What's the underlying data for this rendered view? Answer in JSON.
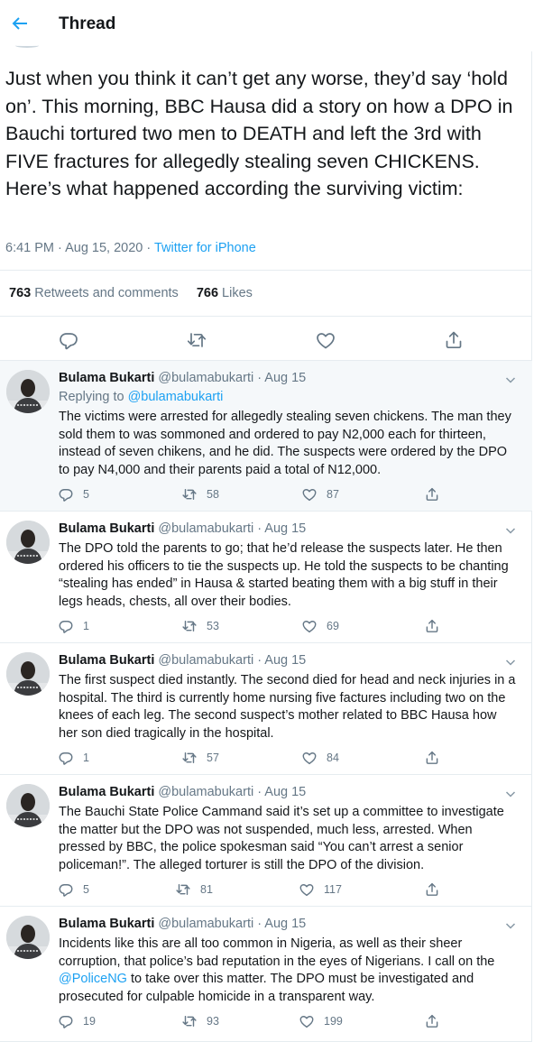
{
  "header": {
    "title": "Thread"
  },
  "main_tweet": {
    "text": "Just when you think it can’t get any worse, they’d say ‘hold on’. This morning, BBC Hausa did a story on how a DPO in Bauchi tortured two men to DEATH and left the 3rd with FIVE fractures for allegedly stealing seven CHICKENS. Here’s what happened according the surviving victim:",
    "time": "6:41 PM · Aug 15, 2020 · ",
    "source": "Twitter for iPhone",
    "retweets_count": "763",
    "retweets_label": "Retweets and comments",
    "likes_count": "766",
    "likes_label": "Likes"
  },
  "replies": [
    {
      "name": "Bulama Bukarti",
      "handle": " @bulamabukarti · Aug 15",
      "replying_prefix": "Replying to ",
      "replying_to": "@bulamabukarti",
      "text": "The victims were arrested for allegedly stealing seven chickens. The man they sold them to was sommoned and ordered to pay N2,000 each for thirteen, instead of seven chikens, and he did. The suspects were ordered by the DPO to pay N4,000 and their parents paid a total of N12,000.",
      "replies": "5",
      "retweets": "58",
      "likes": "87"
    },
    {
      "name": "Bulama Bukarti",
      "handle": " @bulamabukarti · Aug 15",
      "text": "The DPO told the parents to go; that he’d release the suspects later. He then ordered his officers to tie the suspects up. He told the suspects to be chanting “stealing has ended” in Hausa & started beating them with a big stuff in their legs heads, chests, all over their bodies.",
      "replies": "1",
      "retweets": "53",
      "likes": "69"
    },
    {
      "name": "Bulama Bukarti",
      "handle": " @bulamabukarti · Aug 15",
      "text": "The first suspect died instantly. The second died for head and neck injuries in a hospital. The third is currently home nursing five factures including two on the knees of each leg. The second suspect’s mother related to BBC Hausa how her son died tragically in the hospital.",
      "replies": "1",
      "retweets": "57",
      "likes": "84"
    },
    {
      "name": "Bulama Bukarti",
      "handle": " @bulamabukarti · Aug 15",
      "text": "The Bauchi State Police Cammand said it’s set up a committee to investigate the matter but the DPO was not suspended, much less, arrested. When pressed by BBC, the police spokesman said “You can’t arrest a senior policeman!”. The alleged torturer is still the DPO of the division.",
      "replies": "5",
      "retweets": "81",
      "likes": "117"
    },
    {
      "name": "Bulama Bukarti",
      "handle": " @bulamabukarti · Aug 15",
      "text_before": "Incidents like this are all too common in Nigeria, as well as their sheer corruption, that police’s bad reputation in the eyes of Nigerians. I call on the ",
      "mention": "@PoliceNG",
      "text_after": " to take over this matter. The DPO must be investigated and prosecuted for culpable homicide in a transparent way.",
      "replies": "19",
      "retweets": "93",
      "likes": "199"
    }
  ],
  "colors": {
    "accent": "#1da1f2",
    "muted": "#657786",
    "text": "#14171a",
    "highlight_bg": "#f5f8fa"
  },
  "icons": [
    "back-arrow-icon",
    "reply-icon",
    "retweet-icon",
    "like-icon",
    "share-icon",
    "chevron-down-icon",
    "avatar"
  ]
}
